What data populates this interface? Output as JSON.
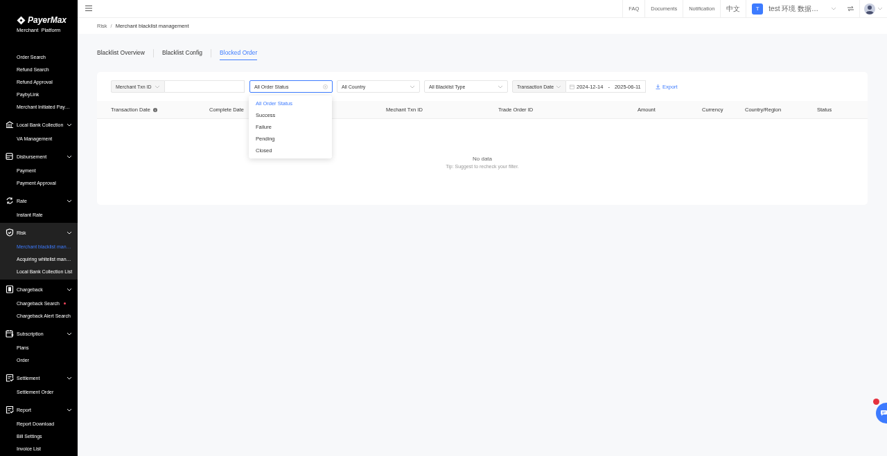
{
  "sidebar": {
    "logo": {
      "name": "PayerMax",
      "subtitle": "Merchant  Platform"
    },
    "items": [
      {
        "label": "Order Search",
        "selected": false
      },
      {
        "label": "Refund Search",
        "selected": false
      },
      {
        "label": "Refund Approval",
        "selected": false
      },
      {
        "label": "PaybyLink",
        "selected": false
      },
      {
        "label": "Merchant Initiated Pay…",
        "selected": false
      }
    ],
    "groups": [
      {
        "label": "Local Bank Collection",
        "kind": "bank",
        "selected": false,
        "children": [
          {
            "label": "VA Management",
            "selected": false
          }
        ]
      },
      {
        "label": "Disbursement",
        "kind": "stack",
        "selected": false,
        "children": [
          {
            "label": "Payment",
            "selected": false
          },
          {
            "label": "Payment Approval",
            "selected": false
          }
        ]
      },
      {
        "label": "Rate",
        "kind": "exchange",
        "selected": false,
        "children": [
          {
            "label": "Instant Rate",
            "selected": false
          }
        ]
      },
      {
        "label": "Risk",
        "kind": "shield",
        "selected": true,
        "children": [
          {
            "label": "Merchant blacklist man…",
            "selected": true
          },
          {
            "label": "Acquiring whitelist man…",
            "selected": false
          },
          {
            "label": "Local Bank Collection List",
            "selected": false
          }
        ]
      },
      {
        "label": "Chargeback",
        "kind": "phone",
        "selected": false,
        "children": [
          {
            "label": "Chargeback Search",
            "selected": false,
            "dot": true
          },
          {
            "label": "Chargeback Alert Search",
            "selected": false
          }
        ]
      },
      {
        "label": "Subscription",
        "kind": "calendar",
        "selected": false,
        "children": [
          {
            "label": "Plans",
            "selected": false
          },
          {
            "label": "Order",
            "selected": false
          }
        ]
      },
      {
        "label": "Settlement",
        "kind": "bill",
        "selected": false,
        "children": [
          {
            "label": "Settlement Order",
            "selected": false
          }
        ]
      },
      {
        "label": "Report",
        "kind": "bill",
        "selected": false,
        "children": [
          {
            "label": "Report Download",
            "selected": false
          },
          {
            "label": "Bill Settings",
            "selected": false
          },
          {
            "label": "Invoice List",
            "selected": false
          }
        ]
      }
    ]
  },
  "header": {
    "links": [
      "FAQ",
      "Documents",
      "Notification",
      "中文"
    ],
    "account": {
      "initial": "T",
      "name": "test 环境 数据…"
    }
  },
  "breadcrumb": [
    "Risk",
    "Merchant blacklist management"
  ],
  "breadcrumb_separator": "/",
  "tabs": [
    {
      "label": "Blacklist Overview",
      "selected": false
    },
    {
      "label": "Blacklist Config",
      "selected": false
    },
    {
      "label": "Blocked Order",
      "selected": true
    }
  ],
  "filters": {
    "id_type": "Merchant Txn ID",
    "order_status": {
      "value": "All Order Status",
      "open": true,
      "options": [
        {
          "label": "All Order Status",
          "selected": true
        },
        {
          "label": "Success",
          "selected": false
        },
        {
          "label": "Failure",
          "selected": false
        },
        {
          "label": "Pending",
          "selected": false
        },
        {
          "label": "Closed",
          "selected": false
        }
      ]
    },
    "country": "All Country",
    "blacklist_type": "All Blacklist Type",
    "date_type": "Transaction Date",
    "date_from": "2024-12-14",
    "date_separator": "-",
    "date_to": "2025-06-11",
    "export": "Export"
  },
  "table": {
    "columns": [
      {
        "label": "Transaction Date",
        "info": true
      },
      {
        "label": "Complete Date",
        "info": false
      },
      {
        "label": "Mechant Txn ID",
        "info": false
      },
      {
        "label": "Trade Order ID",
        "info": false
      },
      {
        "label": "Amount",
        "info": false
      },
      {
        "label": "Currency",
        "info": false
      },
      {
        "label": "Country/Region",
        "info": false
      },
      {
        "label": "Status",
        "info": false
      }
    ],
    "empty": {
      "title": "No data",
      "tip": "Tip: Suggest to recheck your filter."
    }
  }
}
